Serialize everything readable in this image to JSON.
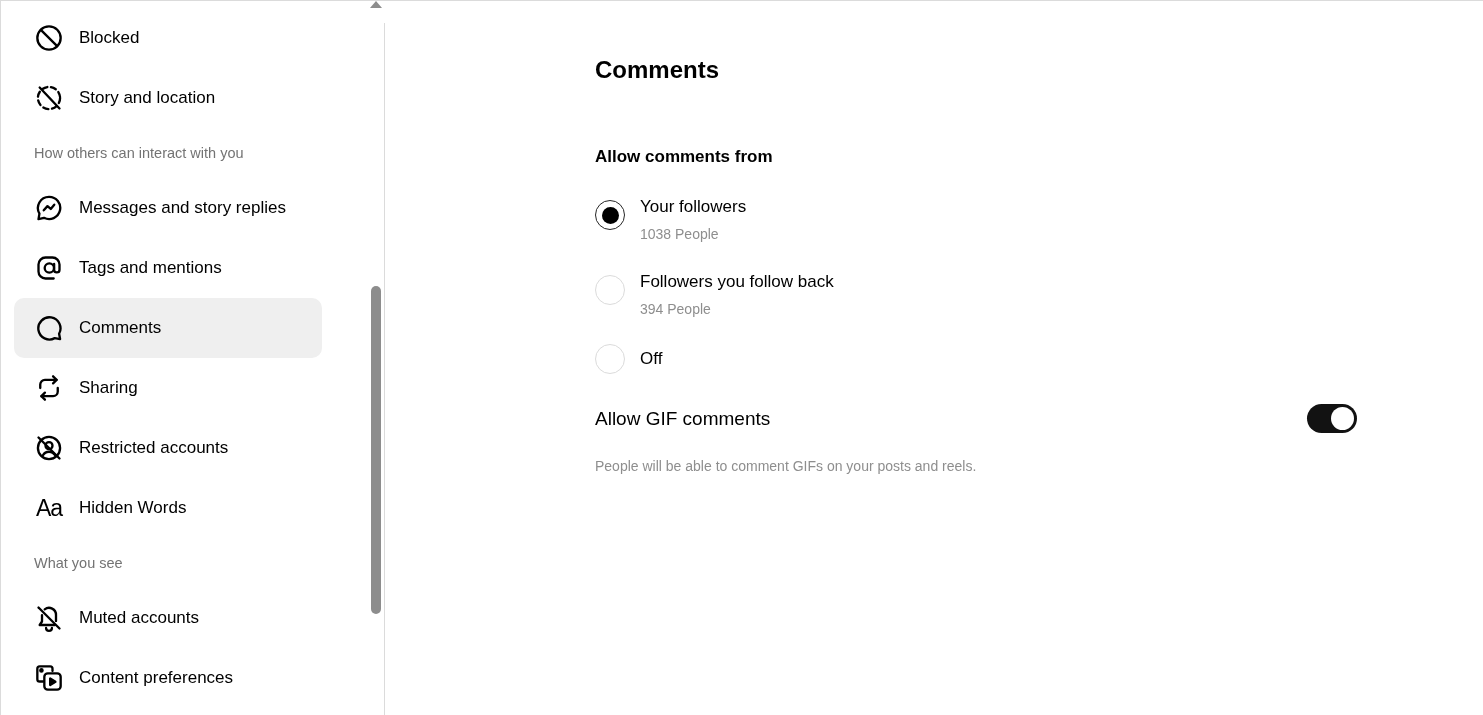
{
  "sidebar": {
    "items": [
      {
        "kind": "item",
        "label": "Blocked",
        "selected": false
      },
      {
        "kind": "item",
        "label": "Story and location",
        "selected": false
      },
      {
        "kind": "header",
        "label": "How others can interact with you"
      },
      {
        "kind": "item",
        "label": "Messages and story replies",
        "selected": false
      },
      {
        "kind": "item",
        "label": "Tags and mentions",
        "selected": false
      },
      {
        "kind": "item",
        "label": "Comments",
        "selected": true
      },
      {
        "kind": "item",
        "label": "Sharing",
        "selected": false
      },
      {
        "kind": "item",
        "label": "Restricted accounts",
        "selected": false
      },
      {
        "kind": "item",
        "label": "Hidden Words",
        "glyph": "Aa",
        "selected": false
      },
      {
        "kind": "header",
        "label": "What you see"
      },
      {
        "kind": "item",
        "label": "Muted accounts",
        "selected": false
      },
      {
        "kind": "item",
        "label": "Content preferences",
        "selected": false
      }
    ]
  },
  "content": {
    "title": "Comments",
    "section_label": "Allow comments from",
    "options": [
      {
        "label": "Your followers",
        "detail": "1038 People",
        "selected": true
      },
      {
        "label": "Followers you follow back",
        "detail": "394 People",
        "selected": false
      },
      {
        "label": "Off",
        "selected": false
      }
    ],
    "gif_setting": {
      "label": "Allow GIF comments",
      "on": true,
      "description": "People will be able to comment GIFs on your posts and reels."
    }
  }
}
